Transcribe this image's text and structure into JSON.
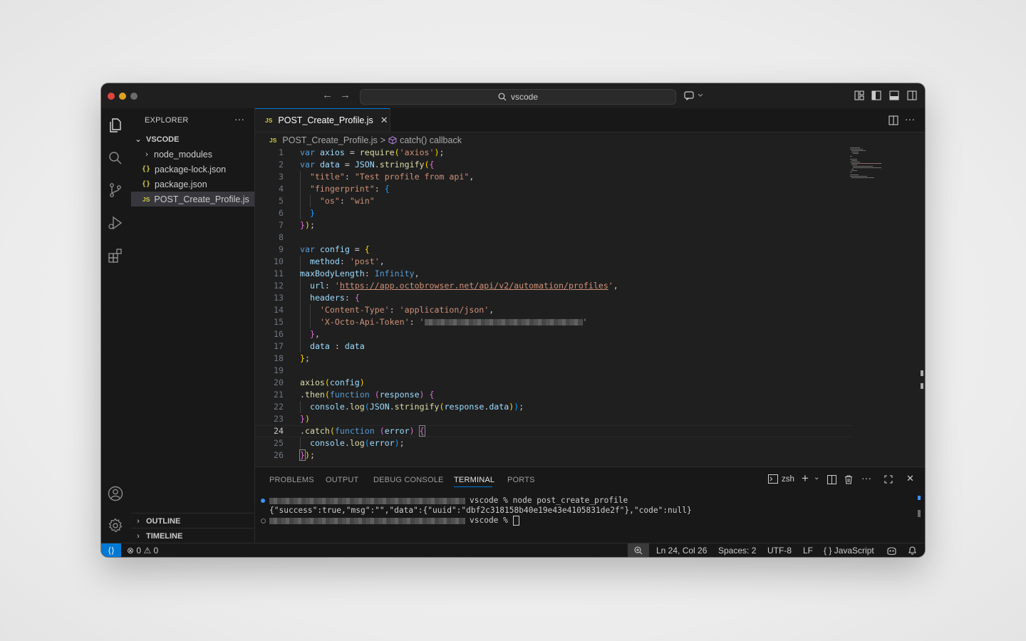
{
  "window": {
    "search_text": "vscode"
  },
  "sidebar": {
    "header": "EXPLORER",
    "more": "···",
    "root": "VSCODE",
    "items": [
      {
        "label": "node_modules",
        "type": "folder"
      },
      {
        "label": "package-lock.json",
        "type": "json"
      },
      {
        "label": "package.json",
        "type": "json"
      },
      {
        "label": "POST_Create_Profile.js",
        "type": "js"
      }
    ],
    "outline": "OUTLINE",
    "timeline": "TIMELINE"
  },
  "editor": {
    "tab_label": "POST_Create_Profile.js",
    "js_badge": "JS",
    "json_badge": "{}",
    "breadcrumb_file": "POST_Create_Profile.js",
    "breadcrumb_sep": ">",
    "breadcrumb_symbol": "catch() callback",
    "active_line": 24,
    "line_numbers": [
      "1",
      "2",
      "3",
      "4",
      "5",
      "6",
      "7",
      "8",
      "9",
      "10",
      "11",
      "12",
      "13",
      "14",
      "15",
      "16",
      "17",
      "18",
      "19",
      "20",
      "21",
      "22",
      "23",
      "24",
      "25",
      "26"
    ]
  },
  "panel": {
    "tabs": [
      "PROBLEMS",
      "OUTPUT",
      "DEBUG CONSOLE",
      "TERMINAL",
      "PORTS"
    ],
    "active_tab": "TERMINAL",
    "shell": "zsh",
    "terminal_lines": [
      "vscode % node post_create_profile",
      "{\"success\":true,\"msg\":\"\",\"data\":{\"uuid\":\"dbf2c318158b40e19e43e4105831de2f\"},\"code\":null}",
      "vscode % "
    ]
  },
  "statusbar": {
    "errors": "0",
    "warnings": "0",
    "position": "Ln 24, Col 26",
    "spaces": "Spaces: 2",
    "encoding": "UTF-8",
    "eol": "LF",
    "language": "JavaScript",
    "language_icon": "{ }"
  },
  "colors": {
    "accent": "#0078d4",
    "keyword": "#569cd6",
    "string": "#ce9178",
    "variable": "#9cdcfe",
    "function": "#dcdcaa"
  }
}
